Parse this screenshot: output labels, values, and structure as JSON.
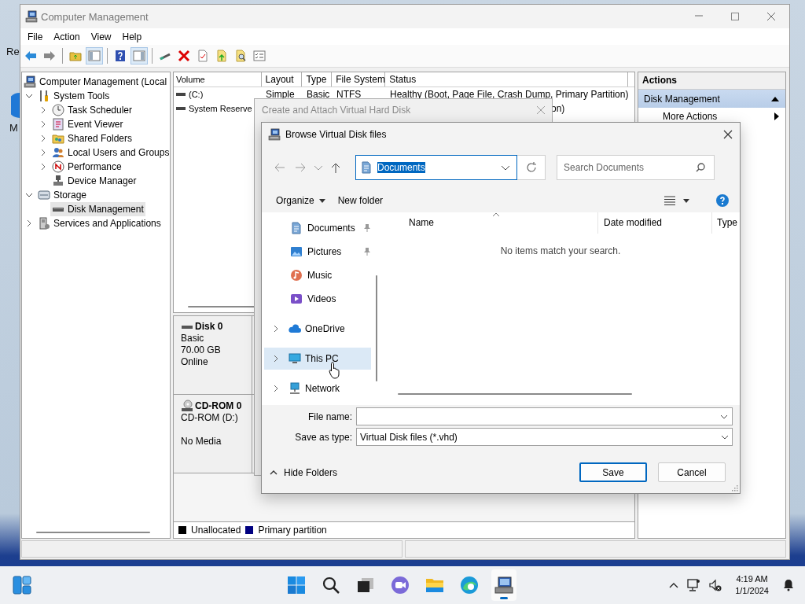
{
  "desktop": {
    "icon_labels": [
      "Re",
      "M"
    ]
  },
  "window": {
    "title": "Computer Management"
  },
  "menu": [
    "File",
    "Action",
    "View",
    "Help"
  ],
  "toolbar": [
    {
      "kind": "back",
      "pressed": false
    },
    {
      "kind": "forward",
      "pressed": false
    },
    {
      "kind": "sep"
    },
    {
      "kind": "folder-up",
      "pressed": false
    },
    {
      "kind": "tree",
      "pressed": true
    },
    {
      "kind": "sep"
    },
    {
      "kind": "help",
      "pressed": false
    },
    {
      "kind": "pane",
      "pressed": true
    },
    {
      "kind": "sep"
    },
    {
      "kind": "drive",
      "pressed": false
    },
    {
      "kind": "delete",
      "pressed": false
    },
    {
      "kind": "doc-check",
      "pressed": false
    },
    {
      "kind": "doc-up",
      "pressed": false
    },
    {
      "kind": "doc-find",
      "pressed": false
    },
    {
      "kind": "checklist",
      "pressed": false
    }
  ],
  "tree": [
    {
      "label": "Computer Management (Local",
      "kind": "computer",
      "selected": false,
      "children": [
        {
          "label": "System Tools",
          "kind": "tools",
          "expanded": true,
          "selected": false,
          "children": [
            {
              "label": "Task Scheduler",
              "kind": "clock",
              "expanded": false,
              "selected": false
            },
            {
              "label": "Event Viewer",
              "kind": "log",
              "expanded": false,
              "selected": false
            },
            {
              "label": "Shared Folders",
              "kind": "shared",
              "expanded": false,
              "selected": false
            },
            {
              "label": "Local Users and Groups",
              "kind": "users",
              "expanded": false,
              "selected": false
            },
            {
              "label": "Performance",
              "kind": "perf",
              "expanded": false,
              "selected": false
            },
            {
              "label": "Device Manager",
              "kind": "device",
              "selected": false
            }
          ]
        },
        {
          "label": "Storage",
          "kind": "storage",
          "expanded": true,
          "selected": false,
          "children": [
            {
              "label": "Disk Management",
              "kind": "disk",
              "selected": true
            }
          ]
        },
        {
          "label": "Services and Applications",
          "kind": "services",
          "expanded": false,
          "selected": false
        }
      ]
    }
  ],
  "volumes": {
    "columns": [
      "Volume",
      "Layout",
      "Type",
      "File System",
      "Status"
    ],
    "rows": [
      {
        "volume": "(C:)",
        "layout": "Simple",
        "type": "Basic",
        "file_system": "NTFS",
        "status": "Healthy (Boot, Page File, Crash Dump, Primary Partition)"
      },
      {
        "volume": "System Reserve",
        "status": "on)"
      }
    ]
  },
  "disks": [
    {
      "name": "Disk 0",
      "kind": "disk",
      "type_line": "Basic",
      "size": "70.00 GB",
      "status": "Online"
    },
    {
      "name": "CD-ROM 0",
      "kind": "cdrom",
      "type_line": "CD-ROM (D:)",
      "status": "No Media"
    }
  ],
  "legend": [
    {
      "label": "Unallocated",
      "color": "#000000"
    },
    {
      "label": "Primary partition",
      "color": "#000080"
    }
  ],
  "actions": {
    "title": "Actions",
    "items": [
      {
        "label": "Disk Management",
        "kind": "section",
        "expanded": true
      },
      {
        "label": "More Actions",
        "kind": "submenu"
      }
    ]
  },
  "wizard": {
    "title": "Create and Attach Virtual Hard Disk"
  },
  "browse": {
    "title": "Browse Virtual Disk files",
    "address": {
      "value": "Documents",
      "text_selected": true
    },
    "search": {
      "placeholder": "Search Documents"
    },
    "commands": {
      "organize": "Organize",
      "new_folder": "New folder"
    },
    "nav": [
      {
        "label": "Documents",
        "kind": "documents",
        "pinned": true,
        "selected": false
      },
      {
        "label": "Pictures",
        "kind": "pictures",
        "pinned": true,
        "selected": false
      },
      {
        "label": "Music",
        "kind": "music",
        "pinned": false,
        "selected": false
      },
      {
        "label": "Videos",
        "kind": "videos",
        "pinned": false,
        "selected": false
      },
      {
        "label": "OneDrive",
        "kind": "onedrive",
        "expanded": false,
        "pinned": false,
        "selected": false
      },
      {
        "label": "This PC",
        "kind": "pc",
        "expanded": false,
        "pinned": false,
        "selected": true
      },
      {
        "label": "Network",
        "kind": "network",
        "expanded": false,
        "pinned": false,
        "selected": false
      }
    ],
    "columns": [
      {
        "label": "Name",
        "sorted": true
      },
      {
        "label": "Date modified",
        "sorted": false
      },
      {
        "label": "Type",
        "sorted": false
      }
    ],
    "empty_message": "No items match your search.",
    "file_name": {
      "label": "File name:"
    },
    "save_type": {
      "label": "Save as type:",
      "value": "Virtual Disk files (*.vhd)"
    },
    "hide_folders": "Hide Folders",
    "buttons": [
      {
        "label": "Save",
        "default": true
      },
      {
        "label": "Cancel",
        "default": false
      }
    ]
  },
  "taskbar": {
    "apps": [
      {
        "kind": "start",
        "active": false
      },
      {
        "kind": "search",
        "active": false
      },
      {
        "kind": "taskview",
        "active": false
      },
      {
        "kind": "chat",
        "active": false
      },
      {
        "kind": "explorer",
        "active": false
      },
      {
        "kind": "browser",
        "active": false
      },
      {
        "kind": "compmgmt",
        "active": true
      }
    ],
    "time": "4:19 AM",
    "date": "1/1/2024"
  }
}
